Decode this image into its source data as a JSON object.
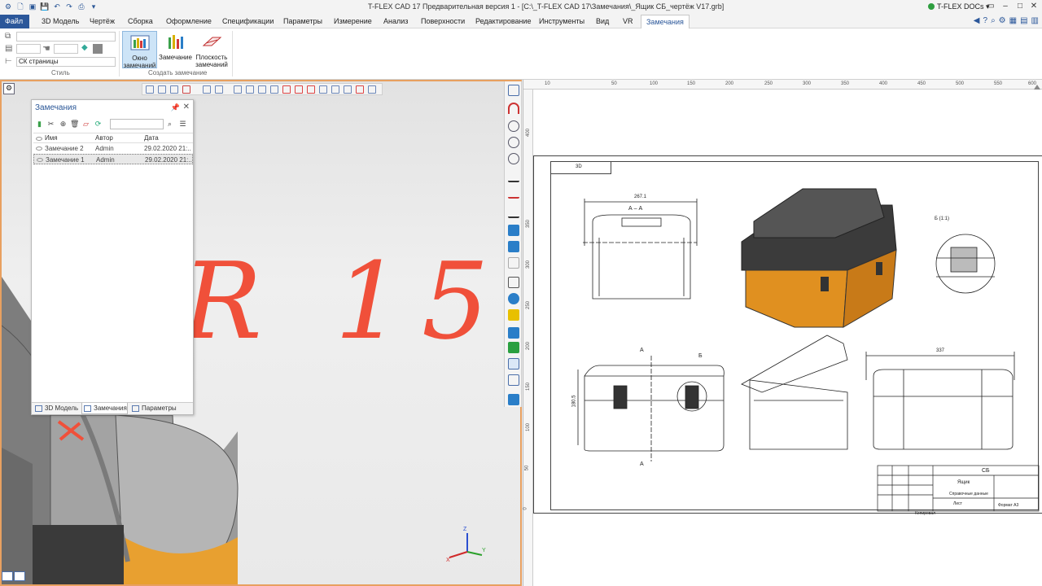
{
  "window": {
    "title": "T-FLEX CAD 17 Предварительная версия 1 - [C:\\_T-FLEX CAD 17\\Замечания\\_Ящик СБ_чертёж V17.grb]",
    "docs_label": "T-FLEX DOCs"
  },
  "menu": {
    "tabs": [
      "Файл",
      "3D Модель",
      "Чертёж",
      "Сборка",
      "Оформление",
      "Спецификации",
      "Параметры",
      "Измерение",
      "Анализ",
      "Поверхности",
      "Редактирование",
      "Инструменты",
      "Вид",
      "VR",
      "Замечания"
    ],
    "active": "Замечания"
  },
  "ribbon": {
    "style_group": "Стиль",
    "create_group": "Создать замечание",
    "cs_value": "СК страницы",
    "btn_notes_window": "Окно замечаний",
    "btn_note": "Замечание",
    "btn_note_plane": "Плоскость замечаний"
  },
  "notes_panel": {
    "title": "Замечания",
    "columns": [
      "Имя",
      "Автор",
      "Дата"
    ],
    "rows": [
      {
        "name": "Замечание 2",
        "author": "Admin",
        "date": "29.02.2020 21:..."
      },
      {
        "name": "Замечание 1",
        "author": "Admin",
        "date": "29.02.2020 21:..."
      }
    ],
    "tabs": [
      "3D Модель",
      "Замечания",
      "Параметры"
    ],
    "active_tab": "Замечания"
  },
  "viewport": {
    "annotation_text": "R 15",
    "accent": "#e8a060",
    "annotation_color": "#f0503a"
  },
  "drawing": {
    "ruler_top": [
      "10",
      "50",
      "100",
      "150",
      "200",
      "250",
      "300",
      "350",
      "400",
      "450",
      "500",
      "550",
      "600"
    ],
    "ruler_left": [
      "400",
      "350",
      "300",
      "250",
      "200",
      "150",
      "100",
      "50",
      "0"
    ],
    "stamp": "3D",
    "section_label": "А – А",
    "view_label": "Б (1:1)",
    "dim_top": "267.1",
    "dim_right": "337",
    "mark_a": "А",
    "mark_b": "Б",
    "dim_height": "180.5",
    "title_block": {
      "code": "СБ",
      "name": "Ящик",
      "row2": "Справочные данные",
      "sheet": "Лист",
      "format": "Формат А3",
      "copied": "Копировал"
    }
  }
}
